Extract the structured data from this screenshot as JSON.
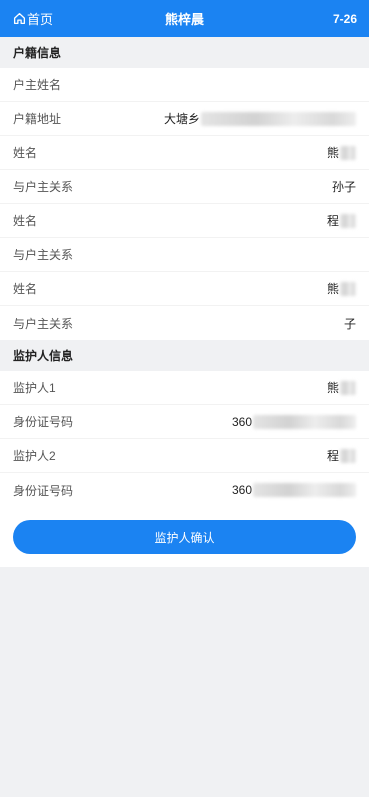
{
  "header": {
    "home_label": "首页",
    "title": "熊梓晨",
    "date": "7-26"
  },
  "household_section": {
    "title": "户籍信息",
    "rows": [
      {
        "label": "户主姓名",
        "value": ""
      },
      {
        "label": "户籍地址",
        "value": "大塘乡"
      },
      {
        "label": "姓名",
        "value": "熊"
      },
      {
        "label": "与户主关系",
        "value": "孙子"
      },
      {
        "label": "姓名",
        "value": "程"
      },
      {
        "label": "与户主关系",
        "value": ""
      },
      {
        "label": "姓名",
        "value": "熊"
      },
      {
        "label": "与户主关系",
        "value": "子"
      }
    ]
  },
  "guardian_section": {
    "title": "监护人信息",
    "rows": [
      {
        "label": "监护人1",
        "value": "熊"
      },
      {
        "label": "身份证号码",
        "value": "360"
      },
      {
        "label": "监护人2",
        "value": "程"
      },
      {
        "label": "身份证号码",
        "value": "360"
      }
    ]
  },
  "confirm_button_label": "监护人确认",
  "colors": {
    "primary": "#1b83f2",
    "background": "#f0f1f3"
  }
}
